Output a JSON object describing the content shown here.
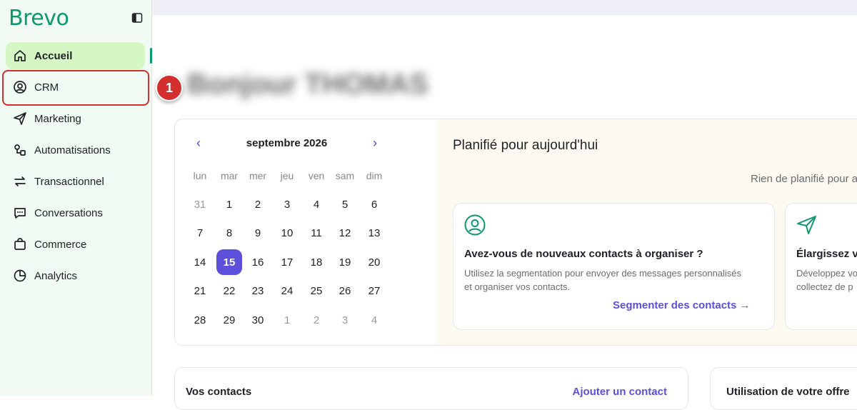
{
  "brand": {
    "logo": "Brevo",
    "accent": "#0b996e"
  },
  "sidebar": {
    "items": [
      {
        "label": "Accueil",
        "icon": "home-icon",
        "active": true
      },
      {
        "label": "CRM",
        "icon": "user-circle-icon"
      },
      {
        "label": "Marketing",
        "icon": "send-icon"
      },
      {
        "label": "Automatisations",
        "icon": "automation-icon"
      },
      {
        "label": "Transactionnel",
        "icon": "arrows-swap-icon"
      },
      {
        "label": "Conversations",
        "icon": "chat-icon"
      },
      {
        "label": "Commerce",
        "icon": "shopping-bag-icon"
      },
      {
        "label": "Analytics",
        "icon": "pie-chart-icon"
      }
    ]
  },
  "annotation": {
    "step": "1",
    "color": "#d32f2f"
  },
  "calendar": {
    "title": "septembre 2026",
    "weekdays": [
      "lun",
      "mar",
      "mer",
      "jeu",
      "ven",
      "sam",
      "dim"
    ],
    "weeks": [
      [
        {
          "d": "31",
          "m": true
        },
        {
          "d": "1"
        },
        {
          "d": "2"
        },
        {
          "d": "3"
        },
        {
          "d": "4"
        },
        {
          "d": "5"
        },
        {
          "d": "6"
        }
      ],
      [
        {
          "d": "7"
        },
        {
          "d": "8"
        },
        {
          "d": "9"
        },
        {
          "d": "10"
        },
        {
          "d": "11"
        },
        {
          "d": "12"
        },
        {
          "d": "13"
        }
      ],
      [
        {
          "d": "14"
        },
        {
          "d": "15",
          "s": true
        },
        {
          "d": "16"
        },
        {
          "d": "17"
        },
        {
          "d": "18"
        },
        {
          "d": "19"
        },
        {
          "d": "20"
        }
      ],
      [
        {
          "d": "21"
        },
        {
          "d": "22"
        },
        {
          "d": "23"
        },
        {
          "d": "24"
        },
        {
          "d": "25"
        },
        {
          "d": "26"
        },
        {
          "d": "27"
        }
      ],
      [
        {
          "d": "28"
        },
        {
          "d": "29"
        },
        {
          "d": "30"
        },
        {
          "d": "1",
          "m": true
        },
        {
          "d": "2",
          "m": true
        },
        {
          "d": "3",
          "m": true
        },
        {
          "d": "4",
          "m": true
        }
      ]
    ]
  },
  "planning": {
    "title": "Planifié pour aujourd'hui",
    "empty_text": "Rien de planifié pour a",
    "suggestions": [
      {
        "title": "Avez-vous de nouveaux contacts à organiser ?",
        "desc1": "Utilisez la segmentation pour envoyer des messages personnalisés",
        "desc2": "et organiser vos contacts.",
        "link": "Segmenter des contacts →"
      },
      {
        "title": "Élargissez v",
        "desc1": "Développez vo",
        "desc2": "collectez de p",
        "link": ""
      }
    ]
  },
  "contacts_card": {
    "title": "Vos contacts",
    "link": "Ajouter un contact"
  },
  "usage_card": {
    "title": "Utilisation de votre offre"
  }
}
